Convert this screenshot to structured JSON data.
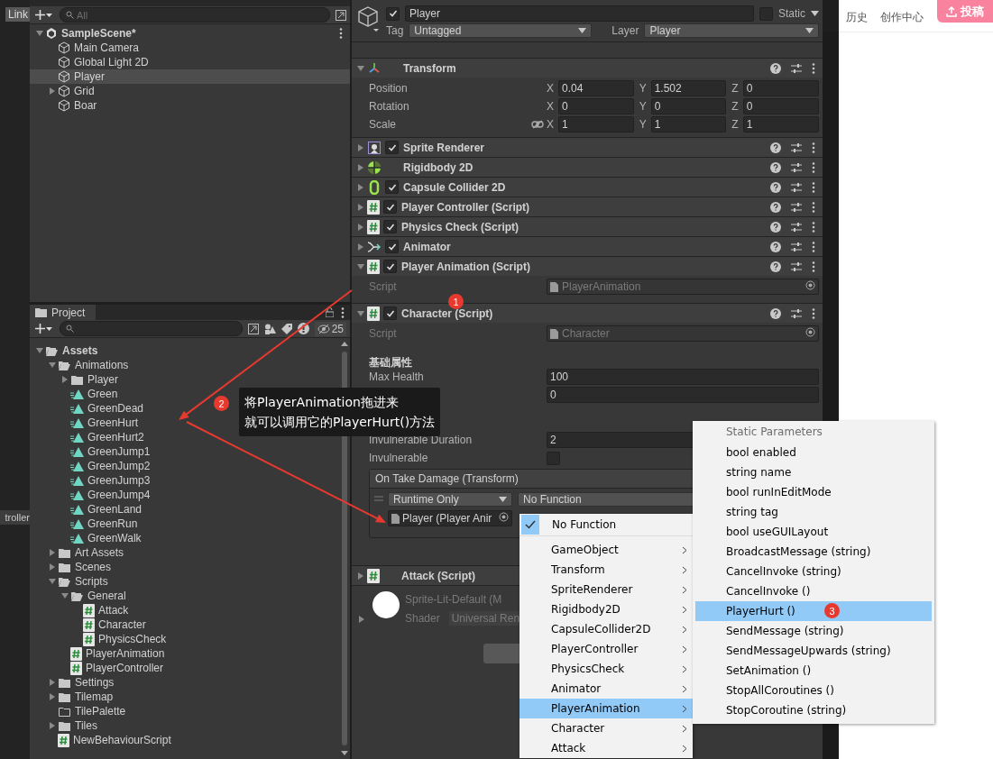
{
  "scene_view": {
    "link_button": "Link",
    "tab": "troller"
  },
  "hierarchy": {
    "search": {
      "placeholder": "All"
    },
    "tree": [
      {
        "name": "SampleScene*",
        "kind": "scene",
        "expanded": true,
        "selected": false,
        "children": [
          {
            "name": "Main Camera",
            "kind": "gameobject",
            "selected": false
          },
          {
            "name": "Global Light 2D",
            "kind": "gameobject",
            "selected": false
          },
          {
            "name": "Player",
            "kind": "gameobject",
            "selected": true
          },
          {
            "name": "Grid",
            "kind": "gameobject",
            "expanded": false,
            "selected": false
          },
          {
            "name": "Boar",
            "kind": "gameobject",
            "selected": false
          }
        ]
      }
    ]
  },
  "project": {
    "tab": "Project",
    "hidden_count": "25",
    "tree": [
      {
        "name": "Assets",
        "kind": "folder",
        "expanded": true,
        "children": [
          {
            "name": "Animations",
            "kind": "folder",
            "expanded": true,
            "children": [
              {
                "name": "Player",
                "kind": "folder",
                "expanded": false
              },
              {
                "name": "Green",
                "kind": "anim"
              },
              {
                "name": "GreenDead",
                "kind": "anim"
              },
              {
                "name": "GreenHurt",
                "kind": "anim"
              },
              {
                "name": "GreenHurt2",
                "kind": "anim"
              },
              {
                "name": "GreenJump1",
                "kind": "anim"
              },
              {
                "name": "GreenJump2",
                "kind": "anim"
              },
              {
                "name": "GreenJump3",
                "kind": "anim"
              },
              {
                "name": "GreenJump4",
                "kind": "anim"
              },
              {
                "name": "GreenLand",
                "kind": "anim"
              },
              {
                "name": "GreenRun",
                "kind": "anim"
              },
              {
                "name": "GreenWalk",
                "kind": "anim"
              }
            ]
          },
          {
            "name": "Art Assets",
            "kind": "folder",
            "expanded": false
          },
          {
            "name": "Scenes",
            "kind": "folder",
            "expanded": false
          },
          {
            "name": "Scripts",
            "kind": "folder",
            "expanded": true,
            "children": [
              {
                "name": "General",
                "kind": "folder",
                "expanded": true,
                "children": [
                  {
                    "name": "Attack",
                    "kind": "script"
                  },
                  {
                    "name": "Character",
                    "kind": "script"
                  },
                  {
                    "name": "PhysicsCheck",
                    "kind": "script"
                  }
                ]
              },
              {
                "name": "PlayerAnimation",
                "kind": "script"
              },
              {
                "name": "PlayerController",
                "kind": "script"
              }
            ]
          },
          {
            "name": "Settings",
            "kind": "folder",
            "expanded": false
          },
          {
            "name": "Tilemap",
            "kind": "folder",
            "expanded": false
          },
          {
            "name": "TilePalette",
            "kind": "empty-folder"
          },
          {
            "name": "Tiles",
            "kind": "folder",
            "expanded": false
          },
          {
            "name": "NewBehaviourScript",
            "kind": "script"
          }
        ]
      }
    ]
  },
  "inspector": {
    "enabled": true,
    "name": "Player",
    "static": false,
    "static_label": "Static",
    "tag_label": "Tag",
    "tag": "Untagged",
    "layer_label": "Layer",
    "layer": "Player",
    "components": [
      {
        "kind": "transform",
        "title": "Transform",
        "expanded": true,
        "rows": [
          {
            "label": "Position",
            "values": [
              {
                "axis": "X",
                "value": "0.04"
              },
              {
                "axis": "Y",
                "value": "1.502"
              },
              {
                "axis": "Z",
                "value": "0"
              }
            ]
          },
          {
            "label": "Rotation",
            "values": [
              {
                "axis": "X",
                "value": "0"
              },
              {
                "axis": "Y",
                "value": "0"
              },
              {
                "axis": "Z",
                "value": "0"
              }
            ]
          },
          {
            "label": "Scale",
            "constrain": false,
            "values": [
              {
                "axis": "X",
                "value": "1"
              },
              {
                "axis": "Y",
                "value": "1"
              },
              {
                "axis": "Z",
                "value": "1"
              }
            ]
          }
        ]
      },
      {
        "kind": "sprite-renderer",
        "title": "Sprite Renderer",
        "enabled": true,
        "expanded": false
      },
      {
        "kind": "rigidbody",
        "title": "Rigidbody 2D",
        "expanded": false
      },
      {
        "kind": "collider",
        "title": "Capsule Collider 2D",
        "enabled": true,
        "expanded": false
      },
      {
        "kind": "script",
        "title": "Player Controller (Script)",
        "enabled": true,
        "expanded": false
      },
      {
        "kind": "script",
        "title": "Physics Check (Script)",
        "enabled": true,
        "expanded": false
      },
      {
        "kind": "animator",
        "title": "Animator",
        "enabled": true,
        "expanded": false
      },
      {
        "kind": "script",
        "title": "Player Animation (Script)",
        "enabled": true,
        "expanded": true,
        "fields": [
          {
            "kind": "script",
            "label": "Script",
            "value": "PlayerAnimation"
          }
        ]
      },
      {
        "kind": "script",
        "title": "Character (Script)",
        "enabled": true,
        "expanded": true,
        "fields": [
          {
            "kind": "script",
            "label": "Script",
            "value": "Character"
          },
          {
            "kind": "header",
            "label": "基础属性"
          },
          {
            "kind": "number",
            "label": "Max Health",
            "value": "100"
          },
          {
            "kind": "number",
            "value": "0"
          },
          {
            "kind": "number",
            "label": "Invulnerable Duration",
            "value": "2"
          },
          {
            "kind": "checkbox",
            "label": "Invulnerable",
            "checked": false
          },
          {
            "kind": "event",
            "title": "On Take Damage (Transform)",
            "mode": "Runtime Only",
            "target": "Player (Player Anir",
            "function": "No Function"
          }
        ]
      },
      {
        "kind": "script",
        "title": "Attack (Script)",
        "expanded": false
      }
    ],
    "material": {
      "name": "Sprite-Lit-Default (M",
      "shader_label": "Shader",
      "shader": "Universal Ren"
    }
  },
  "top_bar": {
    "items": [
      "历史",
      "创作中心"
    ],
    "upload_button": "投稿"
  },
  "function_menu": {
    "items": [
      {
        "label": "No Function",
        "checked": true,
        "submenu": false,
        "selected": false
      },
      {
        "label": "GameObject",
        "submenu": true,
        "selected": false
      },
      {
        "label": "Transform",
        "submenu": true,
        "selected": false
      },
      {
        "label": "SpriteRenderer",
        "submenu": true,
        "selected": false
      },
      {
        "label": "Rigidbody2D",
        "submenu": true,
        "selected": false
      },
      {
        "label": "CapsuleCollider2D",
        "submenu": true,
        "selected": false
      },
      {
        "label": "PlayerController",
        "submenu": true,
        "selected": false
      },
      {
        "label": "PhysicsCheck",
        "submenu": true,
        "selected": false
      },
      {
        "label": "Animator",
        "submenu": true,
        "selected": false
      },
      {
        "label": "PlayerAnimation",
        "submenu": true,
        "selected": true
      },
      {
        "label": "Character",
        "submenu": true,
        "selected": false
      },
      {
        "label": "Attack",
        "submenu": true,
        "selected": false
      }
    ]
  },
  "method_menu": {
    "header": "Static Parameters",
    "items": [
      {
        "label": "bool enabled",
        "selected": false
      },
      {
        "label": "string name",
        "selected": false
      },
      {
        "label": "bool runInEditMode",
        "selected": false
      },
      {
        "label": "string tag",
        "selected": false
      },
      {
        "label": "bool useGUILayout",
        "selected": false
      },
      {
        "label": "BroadcastMessage (string)",
        "selected": false
      },
      {
        "label": "CancelInvoke (string)",
        "selected": false
      },
      {
        "label": "CancelInvoke ()",
        "selected": false
      },
      {
        "label": "PlayerHurt ()",
        "selected": true
      },
      {
        "label": "SendMessage (string)",
        "selected": false
      },
      {
        "label": "SendMessageUpwards (string)",
        "selected": false
      },
      {
        "label": "SetAnimation ()",
        "selected": false
      },
      {
        "label": "StopAllCoroutines ()",
        "selected": false
      },
      {
        "label": "StopCoroutine (string)",
        "selected": false
      }
    ]
  },
  "callout": {
    "lines": [
      "将PlayerAnimation拖进来",
      "就可以调用它的PlayerHurt()方法"
    ]
  },
  "badges": [
    "1",
    "2",
    "3"
  ]
}
